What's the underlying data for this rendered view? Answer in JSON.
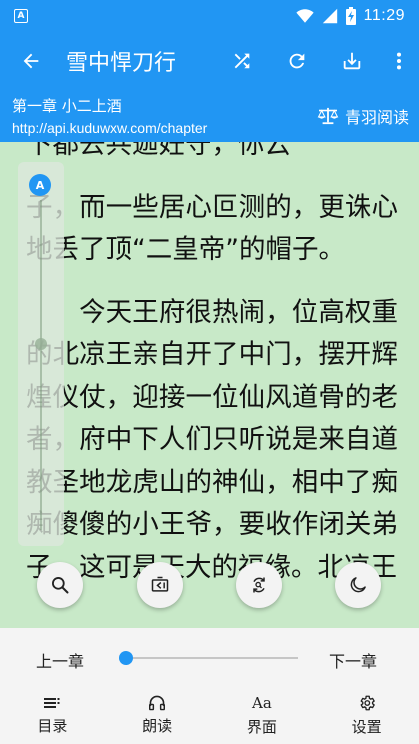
{
  "status_bar": {
    "time": "11:29",
    "notification_badge": "A"
  },
  "toolbar": {
    "title": "雪中悍刀行"
  },
  "chapter": {
    "title": "第一章 小二上酒",
    "url": "http://api.kuduwxw.com/chapter",
    "source_name": "青羽阅读"
  },
  "content": {
    "top_line": "下都去共迦妊守，你云",
    "paragraphs": [
      "子，而一些居心叵测的，更诛心地丢了顶“二皇帝”的帽子。",
      "今天王府很热闹，位高权重的北凉王亲自开了中门，摆开辉煌仪仗，迎接一位仙风道骨的老者，府中下人们只听说是来自道教圣地龙虎山的神仙，相中了痴痴傻傻的小王爷，要收作闭关弟子，这可是天大的福缘。北凉王"
    ]
  },
  "brightness": {
    "auto_label": "A",
    "level": 0.6
  },
  "bottom": {
    "prev_chapter": "上一章",
    "next_chapter": "下一章",
    "progress": 0.0,
    "nav": [
      {
        "label": "目录",
        "icon": "list-icon"
      },
      {
        "label": "朗读",
        "icon": "headphones-icon"
      },
      {
        "label": "界面",
        "icon": "font-icon"
      },
      {
        "label": "设置",
        "icon": "gear-icon"
      }
    ]
  },
  "icons": {
    "back": "arrow-left-icon",
    "shuffle": "shuffle-icon",
    "refresh": "refresh-icon",
    "download": "download-icon",
    "more": "more-vert-icon",
    "search": "search-icon",
    "auto_page": "auto-page-icon",
    "replace": "replace-icon",
    "night": "moon-icon",
    "source": "scales-icon"
  },
  "colors": {
    "primary": "#2196f3",
    "page_background": "#c8e9c8",
    "panel": "#f4f4f4"
  }
}
